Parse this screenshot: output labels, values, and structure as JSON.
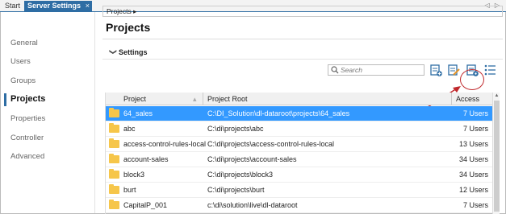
{
  "tabs": {
    "start": "Start",
    "active": "Server Settings",
    "close": "×",
    "nav": "◁ ▷"
  },
  "sidebar": {
    "items": [
      {
        "label": "General"
      },
      {
        "label": "Users"
      },
      {
        "label": "Groups"
      },
      {
        "label": "Projects",
        "active": true
      },
      {
        "label": "Properties"
      },
      {
        "label": "Controller"
      },
      {
        "label": "Advanced"
      }
    ]
  },
  "breadcrumb": "Projects ▸",
  "page_title": "Projects",
  "section": {
    "chevron": "❯",
    "title": "Settings"
  },
  "search": {
    "placeholder": "Search"
  },
  "toolbar": {
    "icons": [
      "add-project-icon",
      "edit-project-icon",
      "project-settings-icon",
      "list-view-icon"
    ]
  },
  "table": {
    "headers": {
      "project": "Project",
      "root": "Project Root",
      "access": "Access"
    },
    "rows": [
      {
        "project": "64_sales",
        "root": "C:\\DI_Solution\\dl-dataroot\\projects\\64_sales",
        "access": "7 Users",
        "selected": true
      },
      {
        "project": "abc",
        "root": "C:\\di\\projects\\abc",
        "access": "7 Users"
      },
      {
        "project": "access-control-rules-local",
        "root": "C:\\di\\projects\\access-control-rules-local",
        "access": "13 Users"
      },
      {
        "project": "account-sales",
        "root": "C:\\di\\projects\\account-sales",
        "access": "34 Users"
      },
      {
        "project": "block3",
        "root": "C:\\di\\projects\\block3",
        "access": "34 Users"
      },
      {
        "project": "burt",
        "root": "C:\\di\\projects\\burt",
        "access": "12 Users"
      },
      {
        "project": "CapitalP_001",
        "root": "c:\\di\\solution\\live\\dl-dataroot",
        "access": "7 Users"
      }
    ]
  },
  "colors": {
    "accent": "#2e6da4",
    "selection": "#3399ff",
    "folder": "#f6c64a",
    "highlight": "#c0282c"
  }
}
